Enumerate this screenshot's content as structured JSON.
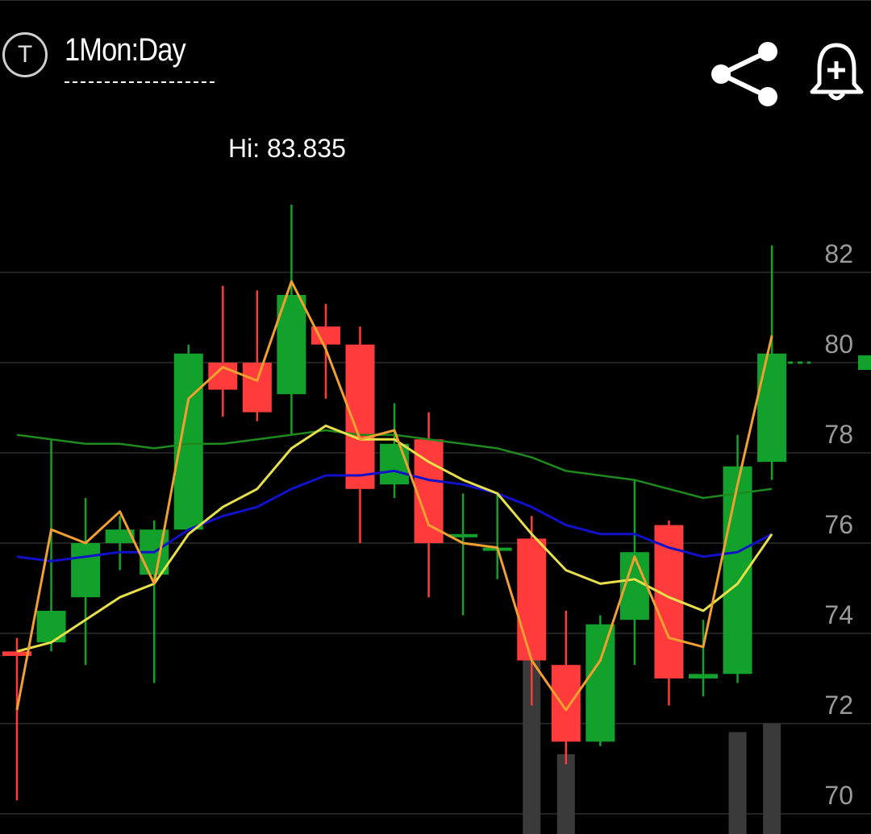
{
  "header": {
    "badge_letter": "T",
    "period_label": "1Mon:Day",
    "share_icon": "share-icon",
    "alert_icon": "bell-plus-icon"
  },
  "chart_data": {
    "type": "candlestick",
    "hi_label": "Hi: 83.835",
    "y_ticks": [
      "82",
      "80",
      "78",
      "76",
      "74",
      "72",
      "70"
    ],
    "ylim": [
      69.5,
      85.0
    ],
    "grid": true,
    "colors": {
      "up": "#12a12a",
      "down": "#ff3b3b",
      "grid": "#2e2e2e",
      "volume": "#3a3a3a",
      "ma_green": "#1e8a1e",
      "ma_blue": "#1111cc",
      "ma_yellow": "#e8e04a",
      "ma_orange": "#f0a030"
    },
    "candles": [
      {
        "o": 73.6,
        "h": 73.9,
        "l": 70.3,
        "c": 73.5
      },
      {
        "o": 73.8,
        "h": 78.3,
        "l": 73.6,
        "c": 74.5
      },
      {
        "o": 74.8,
        "h": 77.0,
        "l": 73.3,
        "c": 76.0
      },
      {
        "o": 76.0,
        "h": 76.6,
        "l": 75.4,
        "c": 76.3
      },
      {
        "o": 75.3,
        "h": 76.5,
        "l": 72.9,
        "c": 76.3
      },
      {
        "o": 76.3,
        "h": 80.4,
        "l": 76.3,
        "c": 80.2
      },
      {
        "o": 80.0,
        "h": 81.7,
        "l": 78.8,
        "c": 79.4
      },
      {
        "o": 80.0,
        "h": 81.6,
        "l": 78.7,
        "c": 78.9
      },
      {
        "o": 79.3,
        "h": 83.5,
        "l": 78.4,
        "c": 81.5
      },
      {
        "o": 80.8,
        "h": 81.3,
        "l": 79.2,
        "c": 80.4
      },
      {
        "o": 80.4,
        "h": 80.8,
        "l": 76.0,
        "c": 77.2
      },
      {
        "o": 77.3,
        "h": 79.1,
        "l": 77.0,
        "c": 78.2
      },
      {
        "o": 78.3,
        "h": 78.9,
        "l": 74.8,
        "c": 76.0
      },
      {
        "o": 76.2,
        "h": 77.1,
        "l": 74.4,
        "c": 76.2
      },
      {
        "o": 75.9,
        "h": 77.1,
        "l": 75.2,
        "c": 75.9
      },
      {
        "o": 76.1,
        "h": 76.6,
        "l": 72.4,
        "c": 73.4
      },
      {
        "o": 73.3,
        "h": 74.5,
        "l": 71.1,
        "c": 71.6
      },
      {
        "o": 71.6,
        "h": 74.4,
        "l": 71.5,
        "c": 74.2
      },
      {
        "o": 74.3,
        "h": 77.4,
        "l": 73.3,
        "c": 75.8
      },
      {
        "o": 76.4,
        "h": 76.5,
        "l": 72.4,
        "c": 73.0
      },
      {
        "o": 73.0,
        "h": 74.3,
        "l": 72.6,
        "c": 73.1
      },
      {
        "o": 73.1,
        "h": 78.4,
        "l": 72.9,
        "c": 77.7
      },
      {
        "o": 77.8,
        "h": 82.6,
        "l": 77.4,
        "c": 80.2
      }
    ],
    "volumes": [
      0,
      0,
      0,
      0,
      0,
      0,
      0,
      0,
      0,
      0,
      0,
      0,
      0,
      0,
      0,
      4.0,
      1.8,
      0,
      0,
      0,
      0,
      2.3,
      2.5
    ],
    "ma_green": [
      78.4,
      78.3,
      78.2,
      78.2,
      78.1,
      78.2,
      78.2,
      78.3,
      78.4,
      78.5,
      78.4,
      78.4,
      78.3,
      78.2,
      78.1,
      77.9,
      77.6,
      77.5,
      77.4,
      77.2,
      77.0,
      77.1,
      77.2
    ],
    "ma_blue": [
      75.7,
      75.6,
      75.7,
      75.8,
      75.8,
      76.3,
      76.6,
      76.8,
      77.2,
      77.5,
      77.5,
      77.6,
      77.4,
      77.3,
      77.1,
      76.8,
      76.4,
      76.2,
      76.2,
      75.9,
      75.7,
      75.8,
      76.2
    ],
    "ma_yellow": [
      73.6,
      73.8,
      74.3,
      74.8,
      75.1,
      76.2,
      76.8,
      77.2,
      78.1,
      78.6,
      78.3,
      78.3,
      77.8,
      77.4,
      77.1,
      76.2,
      75.4,
      75.1,
      75.2,
      74.8,
      74.5,
      75.1,
      76.2
    ],
    "ma_orange": [
      72.3,
      76.3,
      76.0,
      76.7,
      75.1,
      79.2,
      79.9,
      79.6,
      81.8,
      80.3,
      78.3,
      78.5,
      76.4,
      76.0,
      75.9,
      73.4,
      72.3,
      73.4,
      75.7,
      73.9,
      73.7,
      77.3,
      80.6
    ],
    "last_value_marker": 80.0
  }
}
